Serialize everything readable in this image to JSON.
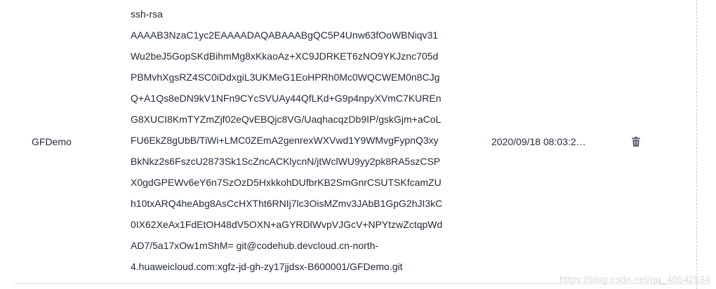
{
  "table": {
    "row": {
      "name": "GFDemo",
      "key_lines": [
        "ssh-rsa",
        "AAAAB3NzaC1yc2EAAAADAQABAAABgQC5P4Unw63fOoWBNiqv31",
        "Wu2beJ5GopSKdBihmMg8xKkaoAz+XC9JDRKET6zNO9YKJznc705d",
        "PBMvhXgsRZ4SC0iDdxgiL3UKMeG1EoHPRh0Mc0WQCWEM0n8CJg",
        "Q+A1Qs8eDN9kV1NFn9CYcSVUAy44QfLKd+G9p4npyXVmC7KUREn",
        "G8XUCI8KmTYZmZjf02eQvEBQjc8VG/UaqhacqzDb9IP/gskGjm+aCoL",
        "FU6EkZ8gUbB/TiWi+LMC0ZEmA2genrexWXVwd1Y9WMvgFypnQ3xy",
        "BkNkz2s6FszcU2873Sk1ScZncACKlycnN/jtWclWU9yy2pk8RA5szCSP",
        "X0gdGPEWv6eY6n7SzOzD5HxkkohDUfbrKB2SmGnrCSUTSKfcamZU",
        "h10txARQ4heAbg8AsCcHXTht6RNIj7lc3OisMZmv3JAbB1GpG2hJI3kC",
        "0IX62XeAx1FdEtOH48dV5OXN+aGYRDlWvpVJGcV+NPYtzwZctqpWd",
        "AD7/5a17xOw1mShM= git@codehub.devcloud.cn-north-",
        "4.huaweicloud.com:xgfz-jd-gh-zy17jjdsx-B600001/GFDemo.git"
      ],
      "time": "2020/09/18 08:03:2…",
      "delete_icon": "trash-icon"
    }
  },
  "watermark": "https://blog.csdn.net/qq_40542534",
  "colors": {
    "text": "#252b3a",
    "icon": "#575d6c",
    "border": "#dfe1e6",
    "watermark": "#d9d9d9"
  }
}
